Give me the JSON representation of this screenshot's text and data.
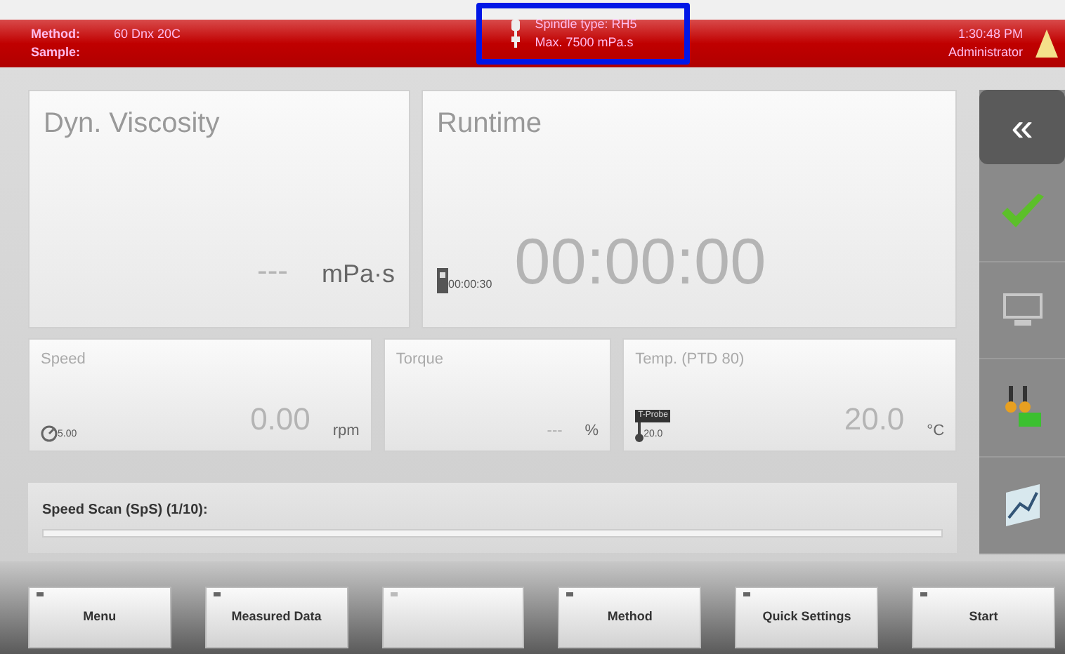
{
  "header": {
    "method_label": "Method:",
    "method_value": "60 Dnx 20C",
    "sample_label": "Sample:",
    "spindle_type": "Spindle type: RH5",
    "spindle_max": "Max. 7500 mPa.s",
    "time": "1:30:48 PM",
    "user": "Administrator",
    "highlighted": true
  },
  "viscosity": {
    "title": "Dyn. Viscosity",
    "value": "---",
    "unit": "mPa·s"
  },
  "runtime": {
    "title": "Runtime",
    "interval": "00:00:30",
    "value": "00:00:00"
  },
  "tiles": [
    {
      "kind": "speed",
      "title": "Speed",
      "sub": "5.00",
      "value": "0.00",
      "unit": "rpm"
    },
    {
      "kind": "plain",
      "title": "Torque",
      "value": "---",
      "unit": "%"
    },
    {
      "kind": "temp",
      "title": "Temp. (PTD 80)",
      "badge": "T-Probe",
      "sub": "20.0",
      "value": "20.0",
      "unit": "°C"
    }
  ],
  "progress": {
    "label": "Speed Scan (SpS) (1/10):",
    "level": 0
  },
  "sidebar": [
    {
      "kind": "collapse",
      "text": "«"
    },
    {
      "kind": "check"
    },
    {
      "kind": "monitor"
    },
    {
      "kind": "probes"
    },
    {
      "kind": "chart"
    }
  ],
  "buttons": [
    {
      "label": "Menu",
      "disabled": false
    },
    {
      "label": "Measured Data",
      "disabled": false
    },
    {
      "disabled": true
    },
    {
      "label": "Method",
      "disabled": false
    },
    {
      "label": "Quick Settings",
      "disabled": false
    },
    {
      "label": "Start",
      "disabled": false
    }
  ]
}
